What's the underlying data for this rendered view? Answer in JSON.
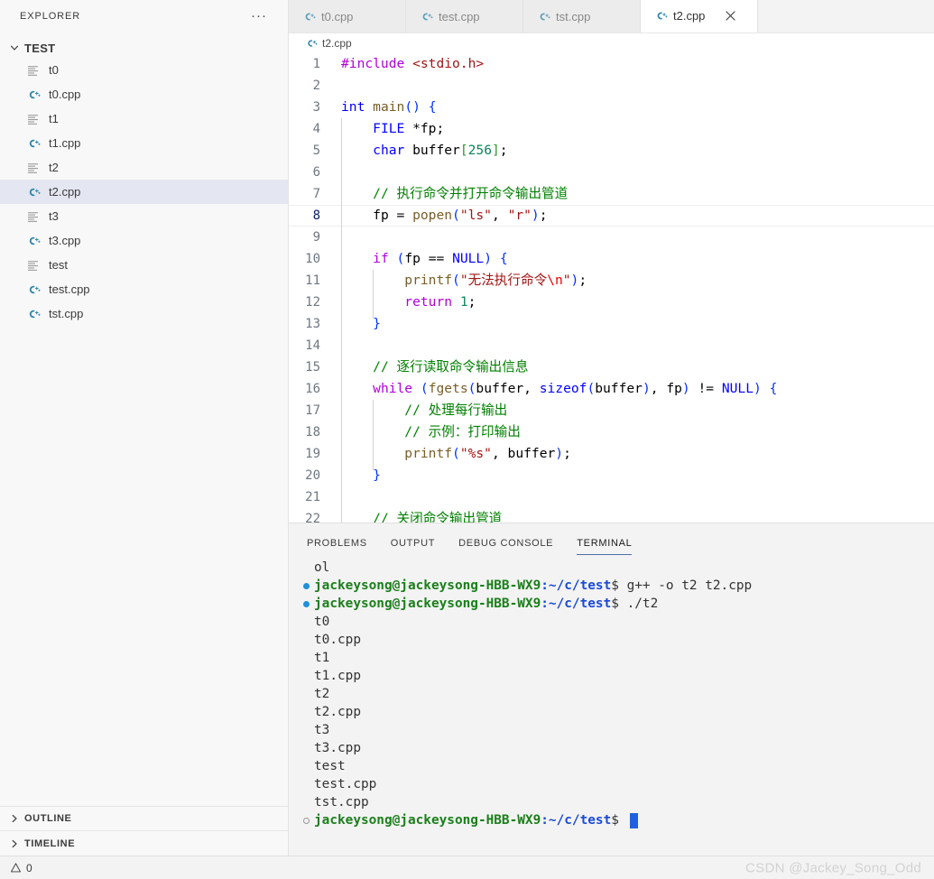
{
  "sidebar": {
    "title": "EXPLORER",
    "more_label": "···",
    "root": "TEST",
    "items": [
      {
        "label": "t0",
        "icon": "text-file-icon",
        "selected": false
      },
      {
        "label": "t0.cpp",
        "icon": "cpp-file-icon",
        "selected": false
      },
      {
        "label": "t1",
        "icon": "text-file-icon",
        "selected": false
      },
      {
        "label": "t1.cpp",
        "icon": "cpp-file-icon",
        "selected": false
      },
      {
        "label": "t2",
        "icon": "text-file-icon",
        "selected": false
      },
      {
        "label": "t2.cpp",
        "icon": "cpp-file-icon",
        "selected": true
      },
      {
        "label": "t3",
        "icon": "text-file-icon",
        "selected": false
      },
      {
        "label": "t3.cpp",
        "icon": "cpp-file-icon",
        "selected": false
      },
      {
        "label": "test",
        "icon": "text-file-icon",
        "selected": false
      },
      {
        "label": "test.cpp",
        "icon": "cpp-file-icon",
        "selected": false
      },
      {
        "label": "tst.cpp",
        "icon": "cpp-file-icon",
        "selected": false
      }
    ],
    "sections": [
      {
        "label": "OUTLINE"
      },
      {
        "label": "TIMELINE"
      }
    ]
  },
  "editor_tabs": [
    {
      "label": "t0.cpp",
      "active": false,
      "closable": false
    },
    {
      "label": "test.cpp",
      "active": false,
      "closable": false
    },
    {
      "label": "tst.cpp",
      "active": false,
      "closable": false
    },
    {
      "label": "t2.cpp",
      "active": true,
      "closable": true
    }
  ],
  "breadcrumb": {
    "label": "t2.cpp"
  },
  "editor": {
    "language": "cpp",
    "active_line": 8,
    "lines": [
      {
        "n": 1,
        "text": "#include <stdio.h>"
      },
      {
        "n": 2,
        "text": ""
      },
      {
        "n": 3,
        "text": "int main() {"
      },
      {
        "n": 4,
        "text": "    FILE *fp;"
      },
      {
        "n": 5,
        "text": "    char buffer[256];"
      },
      {
        "n": 6,
        "text": ""
      },
      {
        "n": 7,
        "text": "    // 执行命令并打开命令输出管道"
      },
      {
        "n": 8,
        "text": "    fp = popen(\"ls\", \"r\");"
      },
      {
        "n": 9,
        "text": ""
      },
      {
        "n": 10,
        "text": "    if (fp == NULL) {"
      },
      {
        "n": 11,
        "text": "        printf(\"无法执行命令\\n\");"
      },
      {
        "n": 12,
        "text": "        return 1;"
      },
      {
        "n": 13,
        "text": "    }"
      },
      {
        "n": 14,
        "text": ""
      },
      {
        "n": 15,
        "text": "    // 逐行读取命令输出信息"
      },
      {
        "n": 16,
        "text": "    while (fgets(buffer, sizeof(buffer), fp) != NULL) {"
      },
      {
        "n": 17,
        "text": "        // 处理每行输出"
      },
      {
        "n": 18,
        "text": "        // 示例：打印输出"
      },
      {
        "n": 19,
        "text": "        printf(\"%s\", buffer);"
      },
      {
        "n": 20,
        "text": "    }"
      },
      {
        "n": 21,
        "text": ""
      },
      {
        "n": 22,
        "text": "    // 关闭命令输出管道"
      }
    ]
  },
  "panel": {
    "tabs": [
      {
        "label": "PROBLEMS",
        "active": false
      },
      {
        "label": "OUTPUT",
        "active": false
      },
      {
        "label": "DEBUG CONSOLE",
        "active": false
      },
      {
        "label": "TERMINAL",
        "active": true
      }
    ],
    "prompt_user": "jackeysong@jackeysong-HBB-WX9",
    "prompt_path": ":~/c/test",
    "prompt_sign": "$ ",
    "lines": [
      {
        "gutter": "none",
        "type": "output",
        "text": "ol"
      },
      {
        "gutter": "filled",
        "type": "command",
        "command": "g++ -o t2 t2.cpp"
      },
      {
        "gutter": "filled",
        "type": "command",
        "command": "./t2"
      },
      {
        "gutter": "none",
        "type": "output",
        "text": "t0"
      },
      {
        "gutter": "none",
        "type": "output",
        "text": "t0.cpp"
      },
      {
        "gutter": "none",
        "type": "output",
        "text": "t1"
      },
      {
        "gutter": "none",
        "type": "output",
        "text": "t1.cpp"
      },
      {
        "gutter": "none",
        "type": "output",
        "text": "t2"
      },
      {
        "gutter": "none",
        "type": "output",
        "text": "t2.cpp"
      },
      {
        "gutter": "none",
        "type": "output",
        "text": "t3"
      },
      {
        "gutter": "none",
        "type": "output",
        "text": "t3.cpp"
      },
      {
        "gutter": "none",
        "type": "output",
        "text": "test"
      },
      {
        "gutter": "none",
        "type": "output",
        "text": "test.cpp"
      },
      {
        "gutter": "none",
        "type": "output",
        "text": "tst.cpp"
      },
      {
        "gutter": "open",
        "type": "cursor",
        "command": ""
      }
    ]
  },
  "statusbar": {
    "warnings_count": "0",
    "watermark": "CSDN @Jackey_Song_Odd"
  },
  "colors": {
    "accent": "#4e6fa8",
    "selection": "#e4e6f1",
    "cpp_icon": "#2e86ab",
    "terminal_user": "#1a7f1a",
    "terminal_path": "#1a4bd6",
    "cursor": "#2060e0",
    "comment": "#008000",
    "keyword": "#0000ff",
    "control": "#af00db",
    "string": "#a31515",
    "number": "#098658",
    "function": "#795e26"
  }
}
